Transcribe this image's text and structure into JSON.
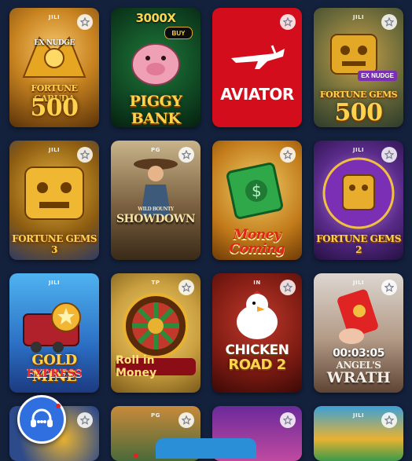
{
  "games": [
    {
      "id": "fortune-garuda-500",
      "title": "FORTUNE GARUDA",
      "number": "500",
      "badge": "EX NUDGE",
      "provider": "JILI"
    },
    {
      "id": "piggy-bank",
      "title": "PIGGY BANK",
      "multiplier": "3000X",
      "badge": "BUY",
      "provider": ""
    },
    {
      "id": "aviator",
      "title": "AVIATOR",
      "provider": ""
    },
    {
      "id": "fortune-gems-500",
      "title": "FORTUNE GEMS",
      "number": "500",
      "badge": "EX NUDGE",
      "provider": "JILI"
    },
    {
      "id": "fortune-gems-3",
      "title": "FORTUNE GEMS 3",
      "provider": "JILI"
    },
    {
      "id": "showdown",
      "title": "SHOWDOWN",
      "subtitle": "WILD BOUNTY",
      "provider": "PG"
    },
    {
      "id": "money-coming",
      "title": "Money",
      "title2": "Coming",
      "provider": ""
    },
    {
      "id": "fortune-gems-2",
      "title": "FORTUNE GEMS 2",
      "provider": "JILI"
    },
    {
      "id": "gold-mine-express",
      "title": "GOLD MINE",
      "title2": "EXPRESS",
      "provider": "JILI"
    },
    {
      "id": "roll-in-money",
      "title": "Roll in Money",
      "provider": "TP"
    },
    {
      "id": "chicken-road-2",
      "title": "CHICKEN",
      "title2": "ROAD 2",
      "provider": "IN"
    },
    {
      "id": "angels-wrath",
      "title": "ANGEL'S",
      "title2": "WRATH",
      "timer": "00:03:05",
      "provider": "JILI"
    },
    {
      "id": "row4-a",
      "provider": ""
    },
    {
      "id": "row4-b",
      "provider": "PG"
    },
    {
      "id": "row4-c",
      "provider": ""
    },
    {
      "id": "row4-d",
      "provider": "JILI"
    }
  ],
  "colors": {
    "background": "#14213d",
    "support_button": "#2f6fe0",
    "favorite_bg": "#ffffff"
  },
  "icons": {
    "favorite": "star-icon",
    "support": "headset-icon"
  }
}
